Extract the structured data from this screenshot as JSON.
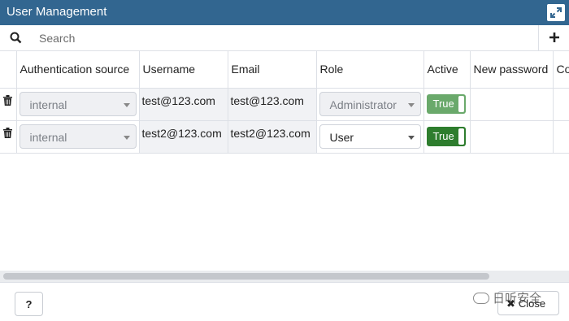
{
  "window": {
    "title": "User Management"
  },
  "search": {
    "placeholder": "Search"
  },
  "columns": {
    "auth_source": "Authentication source",
    "username": "Username",
    "email": "Email",
    "role": "Role",
    "active": "Active",
    "new_password": "New password",
    "confirm_password": "Co"
  },
  "rows": [
    {
      "auth_source": "internal",
      "username": "test@123.com",
      "email": "test@123.com",
      "role": "Administrator",
      "role_editable": false,
      "active": "True",
      "active_color": "#6aa96b"
    },
    {
      "auth_source": "internal",
      "username": "test2@123.com",
      "email": "test2@123.com",
      "role": "User",
      "role_editable": true,
      "active": "True",
      "active_color": "#2e7d2e"
    }
  ],
  "footer": {
    "help_label": "?",
    "close_label": "Close",
    "watermark_text": "日听安全"
  },
  "icons": {
    "maximize": "maximize-icon",
    "search": "search-icon",
    "add": "plus-icon",
    "delete": "trash-icon",
    "close": "close-x-icon"
  },
  "colors": {
    "titlebar": "#326690"
  }
}
